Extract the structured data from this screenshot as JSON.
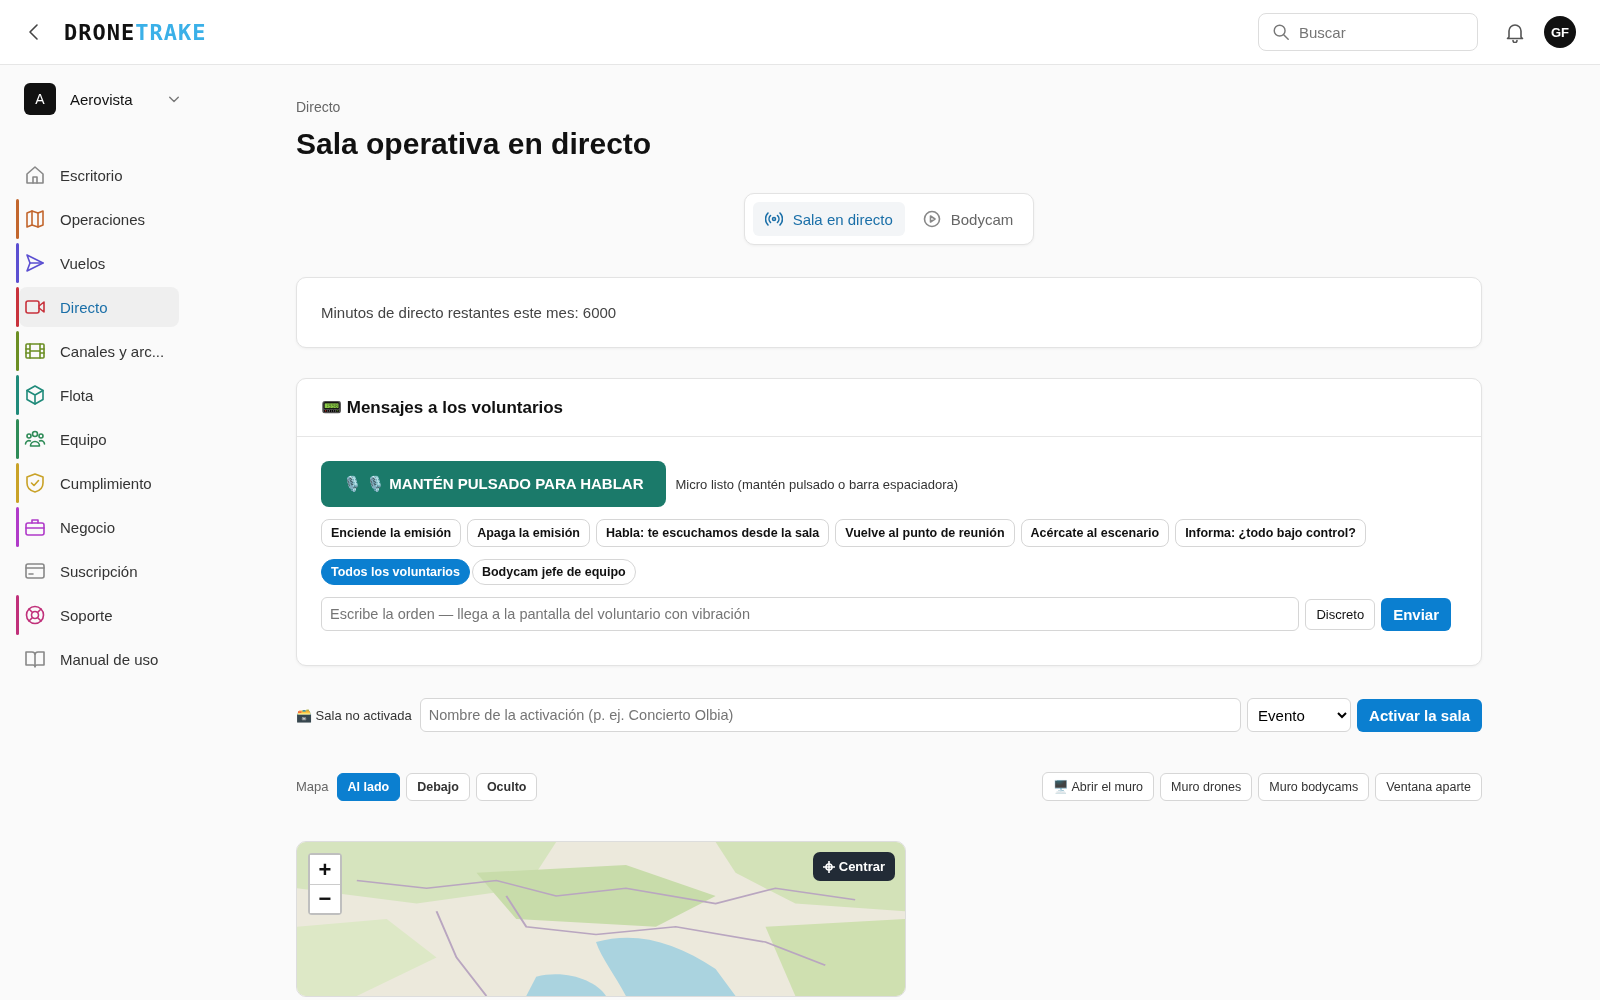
{
  "header": {
    "logo_left": "DRONE",
    "logo_right": "TRAKE",
    "search": {
      "placeholder": "Buscar"
    },
    "avatar": "GF"
  },
  "org": {
    "initial": "A",
    "name": "Aerovista"
  },
  "sidebar": {
    "items": [
      {
        "label": "Escritorio",
        "selected": false
      },
      {
        "label": "Operaciones",
        "selected": false,
        "color": "#c2662d"
      },
      {
        "label": "Vuelos",
        "selected": false,
        "color": "#5b4fd1"
      },
      {
        "label": "Directo",
        "selected": true,
        "color": "#c8323c"
      },
      {
        "label": "Canales y arc...",
        "selected": false,
        "color": "#6b8e23"
      },
      {
        "label": "Flota",
        "selected": false,
        "color": "#1f8a7a"
      },
      {
        "label": "Equipo",
        "selected": false,
        "color": "#2e8b57"
      },
      {
        "label": "Cumplimiento",
        "selected": false,
        "color": "#c9a227"
      },
      {
        "label": "Negocio",
        "selected": false,
        "color": "#b03ac9"
      },
      {
        "label": "Suscripción",
        "selected": false
      },
      {
        "label": "Soporte",
        "selected": false,
        "color": "#c0307a"
      },
      {
        "label": "Manual de uso",
        "selected": false
      }
    ]
  },
  "breadcrumb": "Directo",
  "title": "Sala operativa en directo",
  "tabs": [
    {
      "label": "Sala en directo",
      "selected": true
    },
    {
      "label": "Bodycam",
      "selected": false
    }
  ],
  "minutes_text": "Minutos de directo restantes este mes: 6000",
  "messages": {
    "title": "📟 Mensajes a los voluntarios",
    "talk_button": "🎙️ 🎙️ MANTÉN PULSADO PARA HABLAR",
    "mic_status": "Micro listo (mantén pulsado o barra espaciadora)",
    "quick_orders": [
      "Enciende la emisión",
      "Apaga la emisión",
      "Habla: te escuchamos desde la sala",
      "Vuelve al punto de reunión",
      "Acércate al escenario",
      "Informa: ¿todo bajo control?"
    ],
    "targets": [
      {
        "label": "Todos los voluntarios",
        "selected": true
      },
      {
        "label": "Bodycam jefe de equipo",
        "selected": false
      }
    ],
    "order_field": {
      "placeholder": "Escribe la orden — llega a la pantalla del voluntario con vibración"
    },
    "discreet_button": "Discreto",
    "send_button": "Enviar"
  },
  "activation": {
    "status": "🗃️ Sala no activada",
    "name_field": {
      "placeholder": "Nombre de la activación (p. ej. Concierto Olbia)"
    },
    "type_select": "Evento",
    "activate_button": "Activar la sala"
  },
  "map_layout": {
    "label": "Mapa",
    "options": [
      {
        "label": "Al lado",
        "selected": true
      },
      {
        "label": "Debajo",
        "selected": false
      },
      {
        "label": "Oculto",
        "selected": false
      }
    ]
  },
  "wall_buttons": [
    "🖥️ Abrir el muro",
    "Muro drones",
    "Muro bodycams",
    "Ventana aparte"
  ],
  "map": {
    "kind": "picture",
    "zoom_in": "+",
    "zoom_out": "−",
    "center_button": "Centrar"
  }
}
